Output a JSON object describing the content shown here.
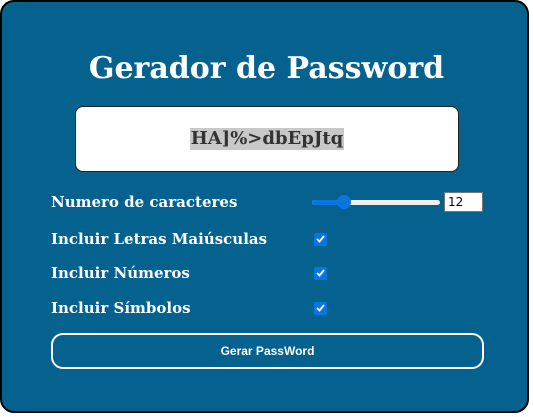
{
  "title": "Gerador de Password",
  "password": "HA]%>dbEpJtq",
  "length_option": {
    "label": "Numero de caracteres",
    "value": "12",
    "slider_fraction": 0.25
  },
  "options": [
    {
      "label": "Incluir Letras Maiúsculas",
      "checked": true
    },
    {
      "label": "Incluir Números",
      "checked": true
    },
    {
      "label": "Incluir Símbolos",
      "checked": true
    }
  ],
  "generate_button": "Gerar PassWord",
  "colors": {
    "card_background": "#05628f",
    "accent": "#0b75e0",
    "text": "#ffffff"
  }
}
